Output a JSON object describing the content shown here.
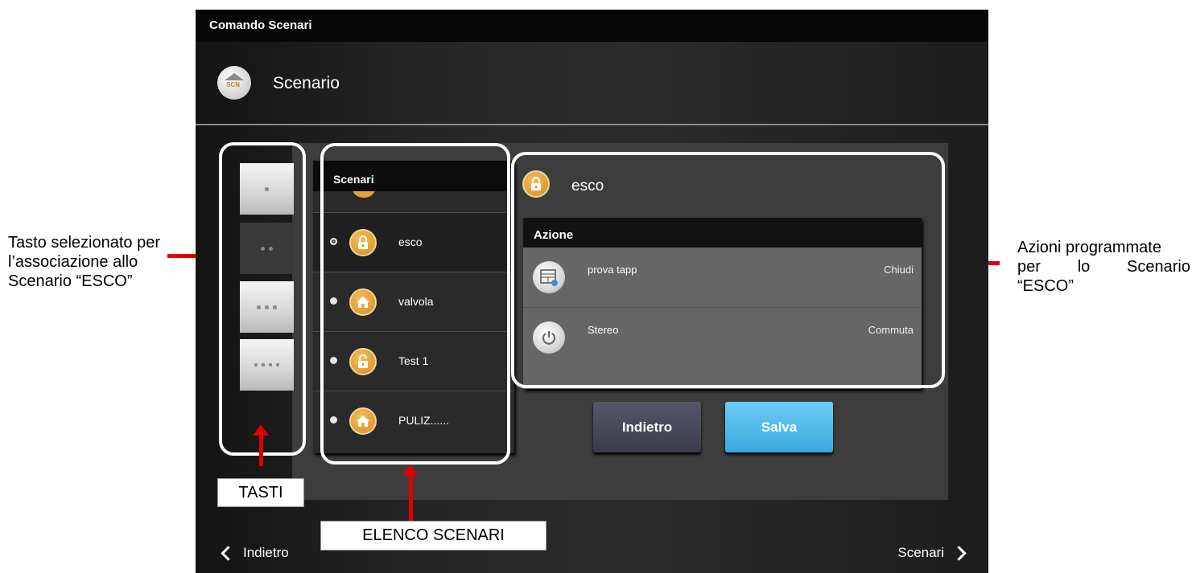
{
  "annotations": {
    "left_text": "Tasto selezionato per l’associazione allo Scenario “ESCO”",
    "right_line1": "Azioni programmate",
    "right_line2_words": [
      "per",
      "lo",
      "Scenario"
    ],
    "right_line3": "“ESCO”",
    "tasti_label": "TASTI",
    "elenco_label": "ELENCO SCENARI"
  },
  "window": {
    "title": "Comando Scenari"
  },
  "header": {
    "title": "Scenario",
    "logo_text": "SCN"
  },
  "keys": [
    {
      "dots": 1,
      "selected": false
    },
    {
      "dots": 2,
      "selected": true
    },
    {
      "dots": 3,
      "selected": false
    },
    {
      "dots": 4,
      "selected": false
    }
  ],
  "scenarios": {
    "header": "Scenari",
    "items": [
      {
        "label": "esco",
        "icon": "lock-icon",
        "selected": true
      },
      {
        "label": "valvola",
        "icon": "home-icon",
        "selected": false
      },
      {
        "label": "Test 1",
        "icon": "unlock-icon",
        "selected": false
      },
      {
        "label": "PULIZ......",
        "icon": "home-icon",
        "selected": false
      }
    ]
  },
  "detail": {
    "title": "esco",
    "title_icon": "lock-icon",
    "table_header": "Azione",
    "actions": [
      {
        "name": "prova tapp",
        "value": "Chiudi",
        "icon": "shutter-icon"
      },
      {
        "name": "Stereo",
        "value": "Commuta",
        "icon": "power-icon"
      }
    ]
  },
  "buttons": {
    "back": "Indietro",
    "save": "Salva"
  },
  "nav": {
    "back": "Indietro",
    "forward": "Scenari"
  },
  "colors": {
    "accent_orange": "#e2a23b",
    "save_blue": "#4fb9e9",
    "arrow_red": "#e00000"
  }
}
